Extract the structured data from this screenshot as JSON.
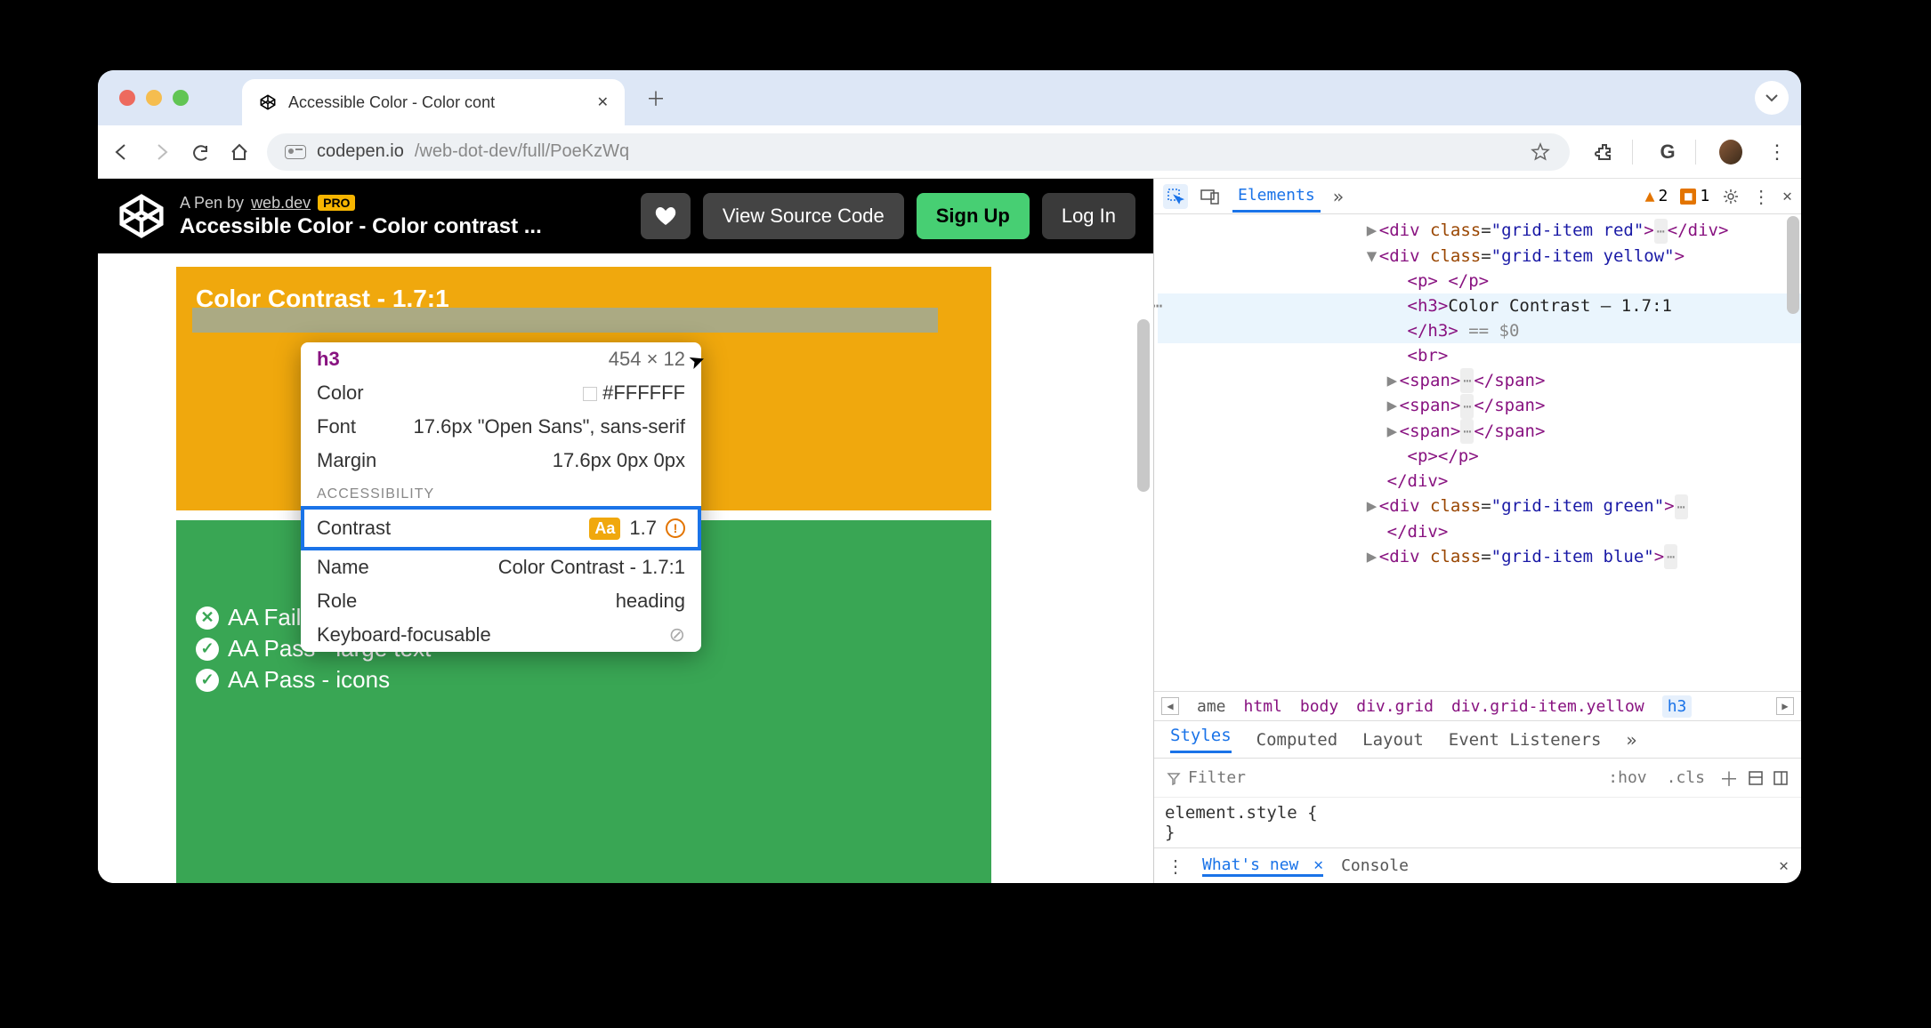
{
  "browser": {
    "tab_title": "Accessible Color - Color cont",
    "url_host": "codepen.io",
    "url_path": "/web-dot-dev/full/PoeKzWq"
  },
  "codepen": {
    "byline_prefix": "A Pen by ",
    "byline_author": "web.dev",
    "pro_badge": "PRO",
    "pen_title": "Accessible Color - Color contrast ...",
    "view_source": "View Source Code",
    "signup": "Sign Up",
    "login": "Log In"
  },
  "page": {
    "yellow_title": "Color Contrast - 1.7:1",
    "green": {
      "fail_regular": "AA Fail - regular text",
      "pass_large": "AA Pass - large text",
      "pass_icons": "AA Pass - icons"
    }
  },
  "inspector_tooltip": {
    "tag": "h3",
    "dims": "454 × 12",
    "color_label": "Color",
    "color_value": "#FFFFFF",
    "font_label": "Font",
    "font_value": "17.6px \"Open Sans\", sans-serif",
    "margin_label": "Margin",
    "margin_value": "17.6px 0px 0px",
    "section": "ACCESSIBILITY",
    "contrast_label": "Contrast",
    "contrast_aa": "Aa",
    "contrast_value": "1.7",
    "name_label": "Name",
    "name_value": "Color Contrast - 1.7:1",
    "role_label": "Role",
    "role_value": "heading",
    "kb_label": "Keyboard-focusable"
  },
  "devtools": {
    "elements_tab": "Elements",
    "issue_warn_count": "2",
    "issue_err_count": "1",
    "dom": {
      "red": "grid-item red",
      "yellow": "grid-item yellow",
      "h3_text": "Color Contrast – 1.7:1",
      "eq0": " == $0",
      "green": "grid-item green",
      "blue": "grid-item blue"
    },
    "crumbs": {
      "ame": "ame",
      "html": "html",
      "body": "body",
      "grid": "div.grid",
      "yellow": "div.grid-item.yellow",
      "h3": "h3"
    },
    "styles_tabs": {
      "styles": "Styles",
      "computed": "Computed",
      "layout": "Layout",
      "events": "Event Listeners"
    },
    "filter_placeholder": "Filter",
    "hov": ":hov",
    "cls": ".cls",
    "element_style_open": "element.style {",
    "element_style_close": "}",
    "drawer": {
      "whatsnew": "What's new",
      "console": "Console"
    }
  }
}
